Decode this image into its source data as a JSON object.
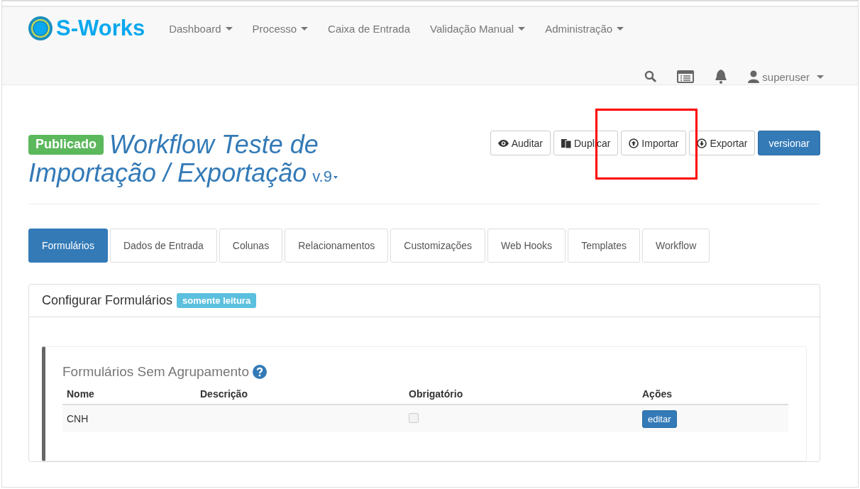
{
  "navbar": {
    "brand": "S-Works",
    "menu": [
      {
        "label": "Dashboard",
        "dropdown": true
      },
      {
        "label": "Processo",
        "dropdown": true
      },
      {
        "label": "Caixa de Entrada",
        "dropdown": false
      },
      {
        "label": "Validação Manual",
        "dropdown": true
      },
      {
        "label": "Administração",
        "dropdown": true
      }
    ],
    "user": "superuser"
  },
  "header": {
    "status": "Publicado",
    "title_lines": [
      "Workflow Teste de",
      "Importação / Exportação"
    ],
    "version": "v.9",
    "buttons": [
      {
        "label": "Auditar",
        "kind": "default"
      },
      {
        "label": "Duplicar",
        "kind": "default"
      },
      {
        "label": "Importar",
        "kind": "default"
      },
      {
        "label": "Exportar",
        "kind": "default"
      },
      {
        "label": "versionar",
        "kind": "primary"
      }
    ]
  },
  "tabs": [
    {
      "label": "Formulários",
      "selected": true
    },
    {
      "label": "Dados de Entrada",
      "selected": false
    },
    {
      "label": "Colunas",
      "selected": false
    },
    {
      "label": "Relacionamentos",
      "selected": false
    },
    {
      "label": "Customizações",
      "selected": false
    },
    {
      "label": "Web Hooks",
      "selected": false
    },
    {
      "label": "Templates",
      "selected": false
    },
    {
      "label": "Workflow",
      "selected": false
    }
  ],
  "panel": {
    "title": "Configurar Formulários",
    "badge": "somente leitura",
    "group": {
      "title": "Formulários Sem Agrupamento",
      "columns": [
        "Nome",
        "Descrição",
        "Obrigatório",
        "Ações"
      ],
      "rows": [
        {
          "name": "CNH",
          "required": false,
          "action": "editar"
        }
      ]
    }
  }
}
